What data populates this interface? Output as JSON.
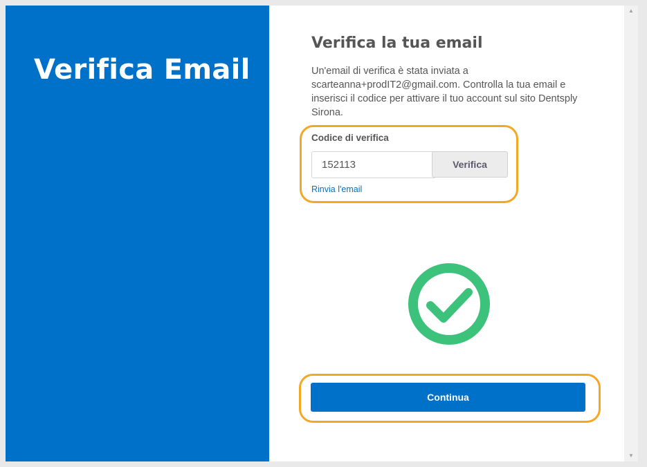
{
  "left": {
    "title": "Verifica Email"
  },
  "main": {
    "heading": "Verifica la tua email",
    "description": "Un'email di verifica è stata inviata a scarteanna+prodIT2@gmail.com. Controlla la tua email e inserisci il codice per attivare il tuo account sul sito Dentsply Sirona.",
    "code_label": "Codice di verifica",
    "code_value": "152113",
    "verify_label": "Verifica",
    "resend_label": "Rinvia l'email",
    "continue_label": "Continua"
  },
  "colors": {
    "brand_blue": "#0071c8",
    "success_green": "#3cc27b",
    "highlight_orange": "#f5a623"
  },
  "icons": {
    "success": "check-circle-icon",
    "scroll_up": "triangle-up-icon",
    "scroll_down": "triangle-down-icon"
  }
}
